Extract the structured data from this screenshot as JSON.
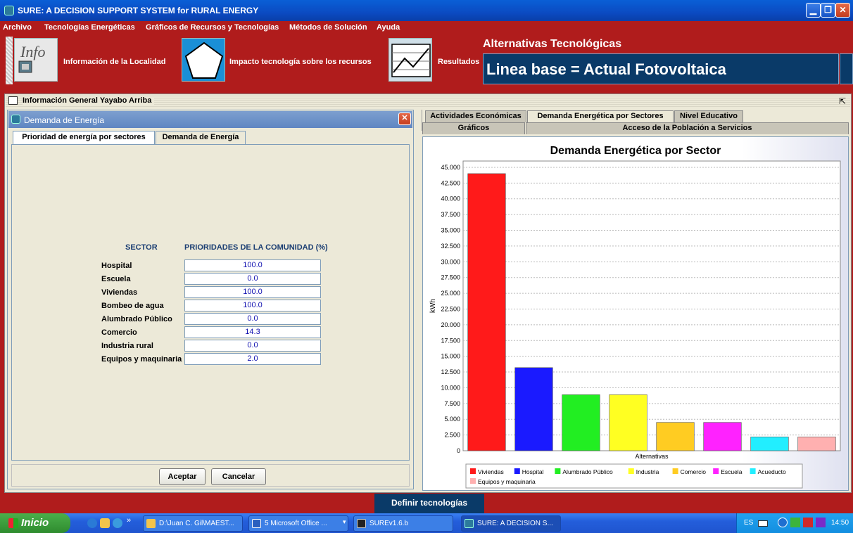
{
  "window": {
    "title": "SURE: A DECISION SUPPORT SYSTEM for RURAL ENERGY",
    "min_glyph": "▁",
    "max_glyph": "❐",
    "close_glyph": "✕"
  },
  "menu": [
    "Archivo",
    "Tecnologías Energéticas",
    "Gráficos de Recursos y Tecnologías",
    "Métodos de Solución",
    "Ayuda"
  ],
  "toolbar": {
    "info_label": "Información de la Localidad",
    "impacto_label": "Impacto tecnología sobre los recursos",
    "resultados_label": "Resultados",
    "alt_title": "Alternativas Tecnológicas",
    "linea_base": "Linea base = Actual Fotovoltaica"
  },
  "inner_frame": {
    "title": "Información General Yayabo Arriba"
  },
  "left_frame": {
    "title": "Demanda de Energía",
    "tabs": [
      "Prioridad de energía por sectores",
      "Demanda de Energía"
    ],
    "active_tab": 0,
    "col_sector": "SECTOR",
    "col_prioridades": "PRIORIDADES DE LA COMUNIDAD (%)",
    "rows": [
      {
        "sector": "Hospital",
        "value": "100.0"
      },
      {
        "sector": "Escuela",
        "value": "0.0"
      },
      {
        "sector": "Viviendas",
        "value": "100.0"
      },
      {
        "sector": "Bombeo de agua",
        "value": "100.0"
      },
      {
        "sector": "Alumbrado Público",
        "value": "0.0"
      },
      {
        "sector": "Comercio",
        "value": "14.3"
      },
      {
        "sector": "Industria rural",
        "value": "0.0"
      },
      {
        "sector": "Equipos y maquinaria",
        "value": "2.0"
      }
    ],
    "aceptar": "Aceptar",
    "cancelar": "Cancelar"
  },
  "right_tabs": {
    "row1": [
      "Actividades Económicas",
      "Demanda Energética por Sectores",
      "Nivel Educativo"
    ],
    "row1_active": 1,
    "row2": [
      "Gráficos",
      "Acceso de la Población a Servicios"
    ]
  },
  "chart_data": {
    "type": "bar",
    "title": "Demanda Energética por Sector",
    "xlabel": "Alternativas",
    "ylabel": "kWh",
    "ylim": [
      0,
      46000
    ],
    "yticks": [
      0,
      2500,
      5000,
      7500,
      10000,
      12500,
      15000,
      17500,
      20000,
      22500,
      25000,
      27500,
      30000,
      32500,
      35000,
      37500,
      40000,
      42500,
      45000
    ],
    "ytick_labels": [
      "0",
      "2.500",
      "5.000",
      "7.500",
      "10.000",
      "12.500",
      "15.000",
      "17.500",
      "20.000",
      "22.500",
      "25.000",
      "27.500",
      "30.000",
      "32.500",
      "35.000",
      "37.500",
      "40.000",
      "42.500",
      "45.000"
    ],
    "grid": true,
    "legend_position": "bottom",
    "series": [
      {
        "name": "Viviendas",
        "value": 44000,
        "color": "#ff1a1a"
      },
      {
        "name": "Hospital",
        "value": 13200,
        "color": "#1a1aff"
      },
      {
        "name": "Alumbrado Público",
        "value": 8900,
        "color": "#22ee22"
      },
      {
        "name": "Industria",
        "value": 8900,
        "color": "#ffff22"
      },
      {
        "name": "Comercio",
        "value": 4500,
        "color": "#ffcc22"
      },
      {
        "name": "Escuela",
        "value": 4500,
        "color": "#ff22ff"
      },
      {
        "name": "Acueducto",
        "value": 2200,
        "color": "#22eeff"
      },
      {
        "name": "Equipos y maquinaria",
        "value": 2200,
        "color": "#ffb0b0"
      }
    ]
  },
  "bottom": {
    "definir": "Definir tecnologías"
  },
  "taskbar": {
    "start": "Inicio",
    "overflow": "»",
    "tasks": [
      {
        "label": "D:\\Juan C. Gil\\MAEST...",
        "icon_color": "#f2c44c"
      },
      {
        "label": "5 Microsoft Office ...",
        "icon_color": "#2a5fbf"
      },
      {
        "label": "SUREv1.6.b",
        "icon_color": "#222222"
      },
      {
        "label": "SURE: A DECISION S...",
        "icon_color": "#2c7a9c"
      }
    ],
    "group_arrow": "▾",
    "tray_lang": "ES",
    "clock": "14:50"
  }
}
